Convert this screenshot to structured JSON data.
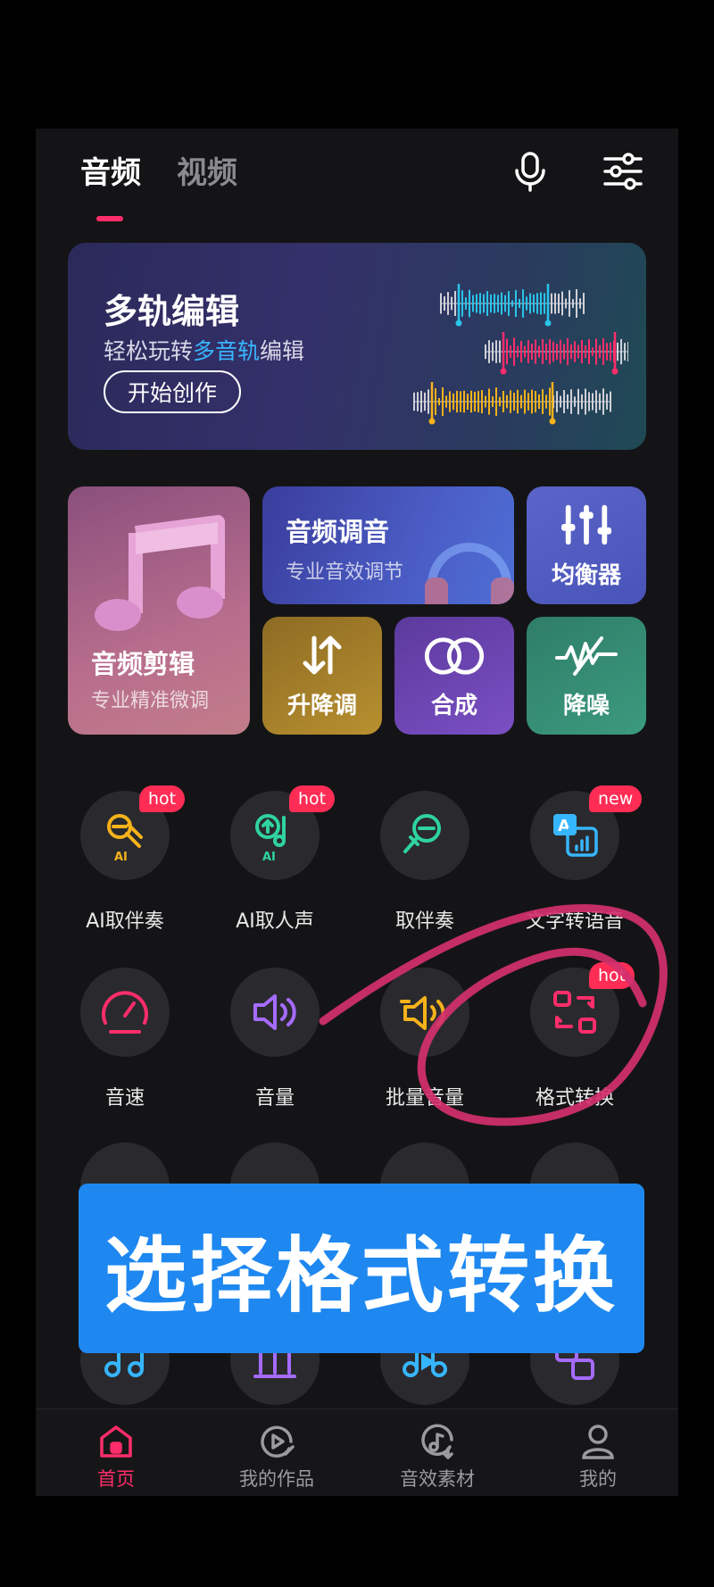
{
  "header": {
    "tabs": [
      {
        "label": "音频",
        "active": true
      },
      {
        "label": "视频",
        "active": false
      }
    ],
    "icons": [
      "microphone-icon",
      "sliders-icon"
    ]
  },
  "banner": {
    "title": "多轨编辑",
    "subtitle_pre": "轻松玩转",
    "subtitle_highlight": "多音轨",
    "subtitle_post": "编辑",
    "button": "开始创作",
    "wave_colors": [
      "#29c4e8",
      "#ff2d6a",
      "#f6b21a"
    ]
  },
  "features": {
    "cut": {
      "title": "音频剪辑",
      "subtitle": "专业精准微调"
    },
    "tune": {
      "title": "音频调音",
      "subtitle": "专业音效调节"
    },
    "eq": {
      "title": "均衡器"
    },
    "pitch": {
      "title": "升降调"
    },
    "mix": {
      "title": "合成"
    },
    "nr": {
      "title": "降噪"
    }
  },
  "tools": [
    {
      "label": "AI取伴奏",
      "badge": "hot",
      "icon": "ai-mic-icon",
      "color": "#f6b21a"
    },
    {
      "label": "AI取人声",
      "badge": "hot",
      "icon": "ai-voice-icon",
      "color": "#2fd3a0"
    },
    {
      "label": "取伴奏",
      "badge": "",
      "icon": "mic-extract-icon",
      "color": "#2fd3a0"
    },
    {
      "label": "文字转语音",
      "badge": "new",
      "icon": "text-to-speech-icon",
      "color": "#36b6ff"
    },
    {
      "label": "音速",
      "badge": "",
      "icon": "speedometer-icon",
      "color": "#ff2d6a"
    },
    {
      "label": "音量",
      "badge": "",
      "icon": "speaker-icon",
      "color": "#a56bff"
    },
    {
      "label": "批量音量",
      "badge": "",
      "icon": "speaker-batch-icon",
      "color": "#f6b21a"
    },
    {
      "label": "格式转换",
      "badge": "hot",
      "icon": "format-convert-icon",
      "color": "#ff2d6a"
    }
  ],
  "overlay_text": "选择格式转换",
  "bottom_nav": [
    {
      "label": "首页",
      "icon": "home-icon",
      "active": true
    },
    {
      "label": "我的作品",
      "icon": "play-edit-icon",
      "active": false
    },
    {
      "label": "音效素材",
      "icon": "music-download-icon",
      "active": false
    },
    {
      "label": "我的",
      "icon": "user-icon",
      "active": false
    }
  ],
  "colors": {
    "accent": "#ff2d6a",
    "overlay": "#1e88f0",
    "annotation": "#d4306e"
  }
}
